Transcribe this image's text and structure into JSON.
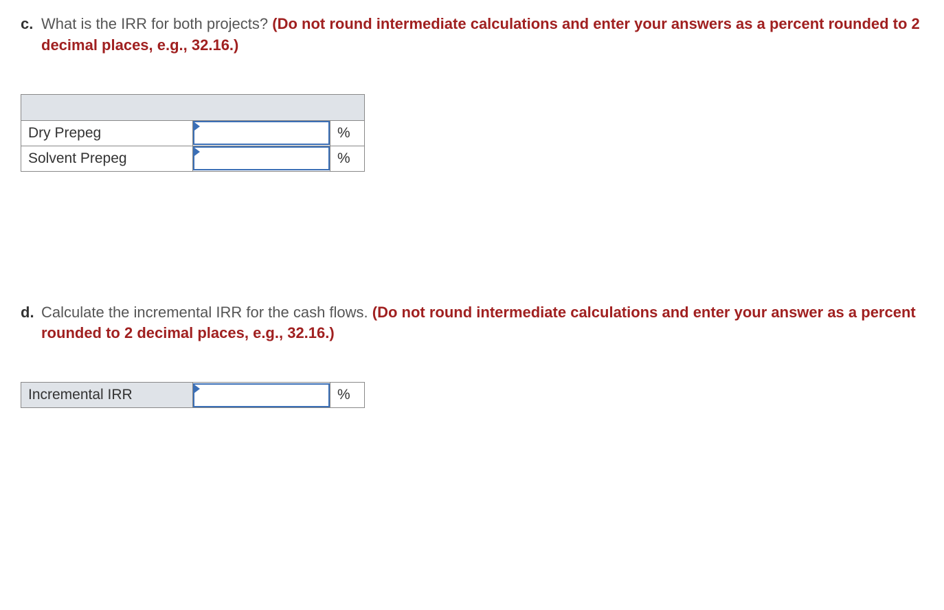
{
  "question_c": {
    "letter": "c.",
    "text": "What is the IRR for both projects? ",
    "instruction": "(Do not round intermediate calculations and enter your answers as a percent rounded to 2 decimal places, e.g., 32.16.)",
    "rows": [
      {
        "label": "Dry Prepeg",
        "unit": "%"
      },
      {
        "label": "Solvent Prepeg",
        "unit": "%"
      }
    ]
  },
  "question_d": {
    "letter": "d.",
    "text": "Calculate the incremental IRR for the cash flows. ",
    "instruction": "(Do not round intermediate calculations and enter your answer as a percent rounded to 2 decimal places, e.g., 32.16.)",
    "rows": [
      {
        "label": "Incremental IRR",
        "unit": "%"
      }
    ]
  }
}
